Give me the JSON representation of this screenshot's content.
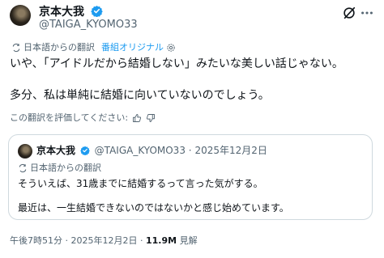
{
  "author": {
    "name": "京本大我",
    "handle": "@TAIGA_KYOMO33"
  },
  "translation": {
    "from_label": "日本語からの翻訳",
    "original_link": "番組オリジナル"
  },
  "post": {
    "line1": "いや、「アイドルだから結婚しない」みたいな美しい話じゃない。",
    "line2": "多分、私は単純に結婚に向いていないのでしょう。"
  },
  "rate_translation": "この翻訳を評価してください:",
  "quote": {
    "name": "京本大我",
    "handle": "@TAIGA_KYOMO33",
    "separator": "·",
    "date": "2025年12月2日",
    "from_label": "日本語からの翻訳",
    "line1": "そういえば、31歳までに結婚するって言った気がする。",
    "line2": "最近は、一生結婚できないのではないかと感じ始めています。"
  },
  "footer": {
    "time": "午後7時51分",
    "separator1": "·",
    "date": "2025年12月2日",
    "separator2": "·",
    "views": "11.9M",
    "views_label": "見解"
  },
  "icons": {
    "verified": "verified-badge-icon",
    "grok": "grok-icon",
    "more": "more-options-icon",
    "translate": "translate-icon",
    "settings": "gear-icon",
    "thumb_up": "thumbs-up-icon",
    "thumb_down": "thumbs-down-icon"
  },
  "colors": {
    "accent": "#1d9bf0",
    "secondary_text": "#536471",
    "border": "#cfd9de"
  }
}
